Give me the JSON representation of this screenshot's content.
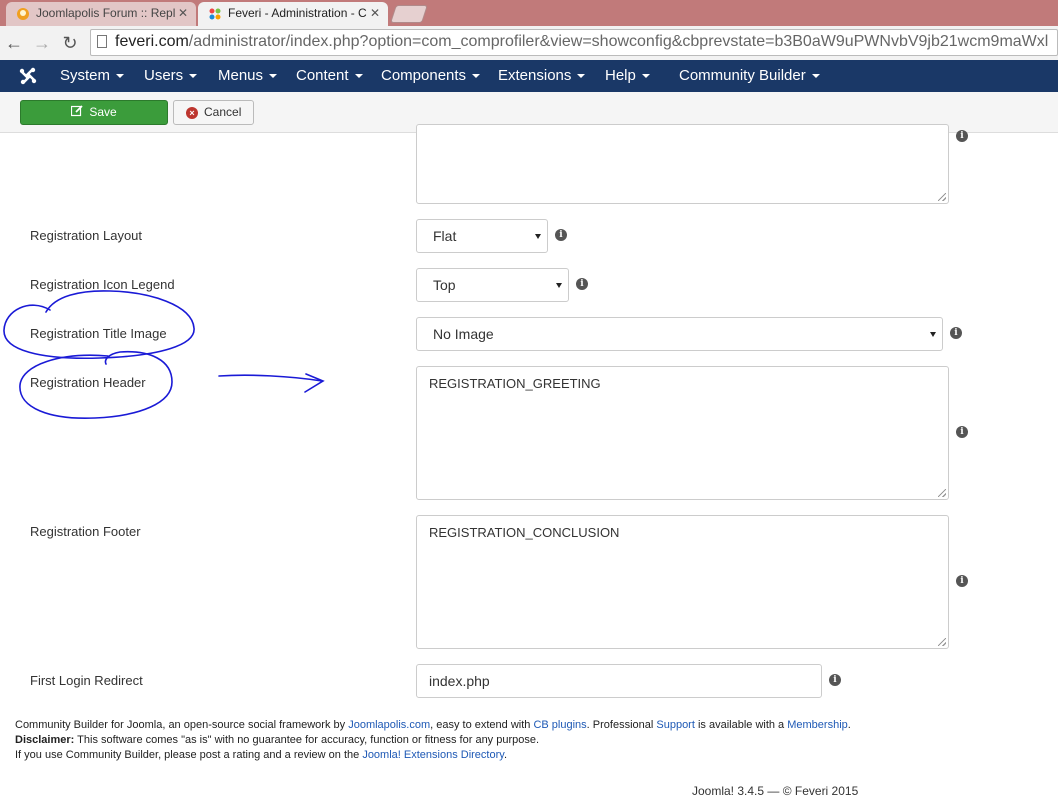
{
  "browser": {
    "tabs": [
      {
        "title": "Joomlapolis Forum :: Repl",
        "active": false
      },
      {
        "title": "Feveri - Administration - C",
        "active": true
      }
    ],
    "url_host": "feveri.com",
    "url_path": "/administrator/index.php?option=com_comprofiler&view=showconfig&cbprevstate=b3B0aW9uPWNvbV9jb21wcm9maWxl"
  },
  "navbar": {
    "items": [
      "System",
      "Users",
      "Menus",
      "Content",
      "Components",
      "Extensions",
      "Help",
      "Community Builder"
    ]
  },
  "toolbar": {
    "save_label": "Save",
    "cancel_label": "Cancel"
  },
  "form": {
    "registration_layout": {
      "label": "Registration Layout",
      "value": "Flat"
    },
    "registration_icon_legend": {
      "label": "Registration Icon Legend",
      "value": "Top"
    },
    "registration_title_image": {
      "label": "Registration Title Image",
      "value": "No Image"
    },
    "registration_header": {
      "label": "Registration Header",
      "value": "REGISTRATION_GREETING"
    },
    "registration_footer": {
      "label": "Registration Footer",
      "value": "REGISTRATION_CONCLUSION"
    },
    "first_login_redirect": {
      "label": "First Login Redirect",
      "value": "index.php"
    }
  },
  "footer": {
    "line1_a": "Community Builder for Joomla, an open-source social framework by ",
    "link_joomlapolis": "Joomlapolis.com",
    "line1_b": ", easy to extend with ",
    "link_cb_plugins": "CB plugins",
    "line1_c": ". Professional ",
    "link_support": "Support",
    "line1_d": " is available with a ",
    "link_membership": "Membership",
    "line1_e": ".",
    "disclaimer_label": "Disclaimer:",
    "disclaimer_text": " This software comes \"as is\" with no guarantee for accuracy, function or fitness for any purpose.",
    "line3_a": "If you use Community Builder, please post a rating and a review on the ",
    "link_jed": "Joomla! Extensions Directory",
    "line3_b": ".",
    "version": "Joomla! 3.4.5  —  © Feveri 2015"
  },
  "colors": {
    "navbar_bg": "#1a3867",
    "save_button": "#3b9c3b",
    "annotation_ink": "#1a1ad6",
    "link": "#1e59b5"
  }
}
